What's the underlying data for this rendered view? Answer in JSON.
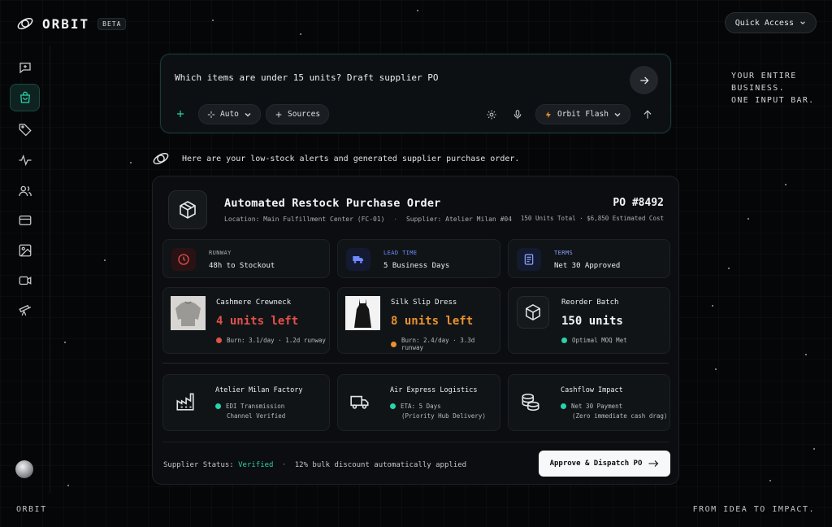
{
  "brand": {
    "name": "ORBIT",
    "badge": "BETA"
  },
  "header": {
    "quick_access": "Quick Access"
  },
  "tagline": {
    "line1": "YOUR ENTIRE",
    "line2": "BUSINESS.",
    "line3": "ONE INPUT BAR."
  },
  "sidebar": {
    "items": [
      {
        "icon": "chat-plus-icon",
        "active": false
      },
      {
        "icon": "shopping-bag-icon",
        "active": true
      },
      {
        "icon": "tag-icon",
        "active": false
      },
      {
        "icon": "activity-icon",
        "active": false
      },
      {
        "icon": "users-icon",
        "active": false
      },
      {
        "icon": "credit-card-icon",
        "active": false
      },
      {
        "icon": "image-icon",
        "active": false
      },
      {
        "icon": "video-icon",
        "active": false
      },
      {
        "icon": "telescope-icon",
        "active": false
      }
    ]
  },
  "prompt": {
    "text": "Which items are under 15 units? Draft supplier PO",
    "auto_label": "Auto",
    "sources_label": "Sources",
    "model_label": "Orbit Flash"
  },
  "assistant": {
    "message": "Here are your low-stock alerts and generated supplier purchase order."
  },
  "order": {
    "title": "Automated Restock Purchase Order",
    "location": "Location: Main Fulfillment Center (FC-01)",
    "separator": "·",
    "supplier": "Supplier: Atelier Milan #04",
    "po_number": "PO #8492",
    "po_meta": "150 Units Total · $6,850 Estimated Cost",
    "tiles": [
      {
        "label": "RUNWAY",
        "value": "48h to Stockout",
        "color": "#e0524a"
      },
      {
        "label": "LEAD TIME",
        "value": "5 Business Days",
        "color": "#6f8cff"
      },
      {
        "label": "TERMS",
        "value": "Net 30 Approved",
        "color": "#8aa6ff"
      }
    ],
    "products": [
      {
        "name": "Cashmere Crewneck",
        "units": "4 units left",
        "burn": "Burn: 3.1/day · 1.2d runway",
        "color": "#e0524a"
      },
      {
        "name": "Silk Slip Dress",
        "units": "8 units left",
        "burn": "Burn: 2.4/day · 3.3d runway",
        "color": "#e8922e"
      },
      {
        "name": "Reorder Batch",
        "units": "150 units",
        "burn": "Optimal MOQ Met",
        "color": "#29d3ac"
      }
    ],
    "logistics": [
      {
        "title": "Atelier Milan Factory",
        "line1": "EDI Transmission",
        "line2": "Channel Verified"
      },
      {
        "title": "Air Express Logistics",
        "line1": "ETA: 5 Days",
        "line2": "(Priority Hub Delivery)"
      },
      {
        "title": "Cashflow Impact",
        "line1": "Net 30 Payment",
        "line2": "(Zero immediate cash drag)"
      }
    ],
    "status_prefix": "Supplier Status:",
    "status_value": "Verified",
    "status_sep": "·",
    "status_note": "12% bulk discount automatically applied",
    "approve_label": "Approve & Dispatch PO"
  },
  "footer": {
    "left": "ORBIT",
    "right": "FROM IDEA TO IMPACT."
  },
  "colors": {
    "accent": "#29d3ac",
    "background": "#050608",
    "danger": "#e0524a",
    "warning": "#e8922e"
  }
}
